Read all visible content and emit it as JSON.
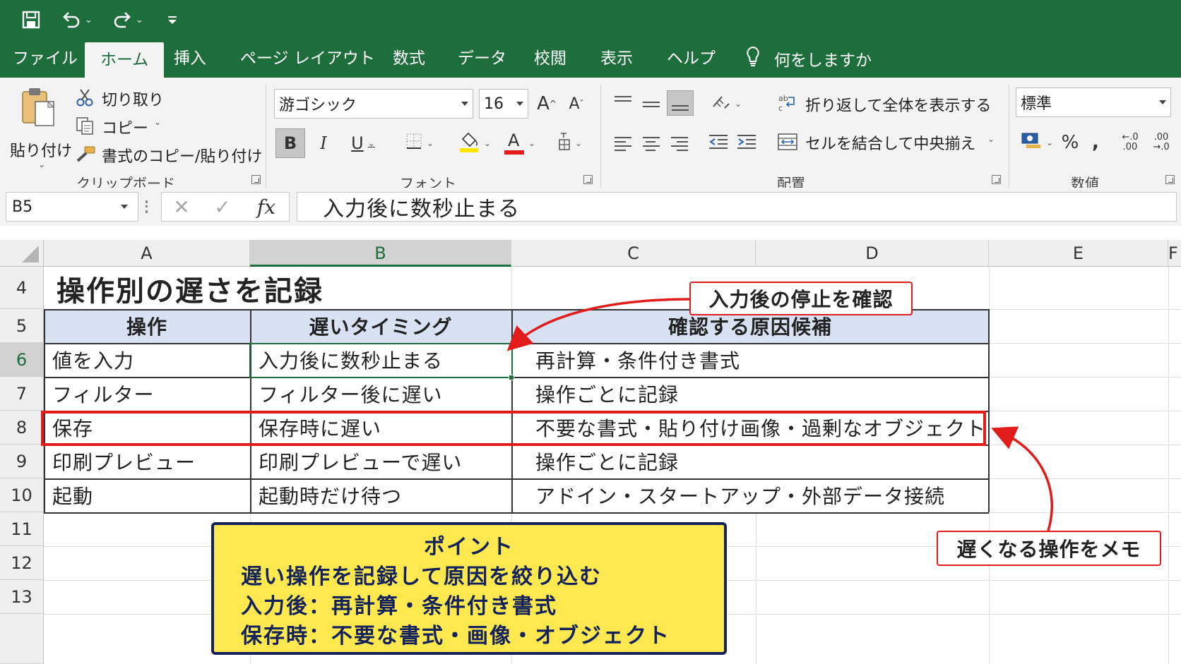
{
  "colors": {
    "excel_green": "#1e6e3c",
    "callout_red": "#e21b1b",
    "header_fill": "#d9e2f3",
    "point_fill": "#fde84f",
    "point_border": "#13225a"
  },
  "quick_access": {
    "icons": [
      "save-icon",
      "undo-icon",
      "redo-icon",
      "customize-icon"
    ]
  },
  "menu": {
    "tabs": [
      "ファイル",
      "ホーム",
      "挿入",
      "ページ レイアウト",
      "数式",
      "データ",
      "校閲",
      "表示",
      "ヘルプ"
    ],
    "active": "ホーム",
    "tell_me": "何をしますか"
  },
  "ribbon": {
    "clipboard": {
      "paste": "貼り付け",
      "cut": "切り取り",
      "copy": "コピー",
      "format_painter": "書式のコピー/貼り付け",
      "label": "クリップボード"
    },
    "font": {
      "font_name": "游ゴシック",
      "font_size": "16",
      "bold": "B",
      "italic": "I",
      "underline": "U",
      "font_color_glyph": "A",
      "grow_glyph": "A",
      "shrink_glyph": "A",
      "label": "フォント"
    },
    "alignment": {
      "wrap_text": "折り返して全体を表示する",
      "merge_center": "セルを結合して中央揃え",
      "label": "配置"
    },
    "number": {
      "format": "標準",
      "percent": "%",
      "comma": ",",
      "inc_decimal": "←.0 .00",
      "dec_decimal": ".00 →.0",
      "label": "数値"
    }
  },
  "formula_bar": {
    "name_box": "B5",
    "fx": "fx",
    "content": "入力後に数秒止まる"
  },
  "sheet": {
    "columns": [
      "A",
      "B",
      "C",
      "D",
      "E",
      "F"
    ],
    "rows": [
      "4",
      "5",
      "6",
      "7",
      "8",
      "9",
      "10",
      "11",
      "12",
      "13"
    ],
    "title": "操作別の遅さを記録",
    "headers": [
      "操作",
      "遅いタイミング",
      "確認する原因候補"
    ],
    "data_rows": [
      [
        "値を入力",
        "入力後に数秒止まる",
        "再計算・条件付き書式"
      ],
      [
        "フィルター",
        "フィルター後に遅い",
        "操作ごとに記録"
      ],
      [
        "保存",
        "保存時に遅い",
        "不要な書式・貼り付け画像・過剰なオブジェクト"
      ],
      [
        "印刷プレビュー",
        "印刷プレビューで遅い",
        "操作ごとに記録"
      ],
      [
        "起動",
        "起動時だけ待つ",
        "アドイン・スタートアップ・外部データ接続"
      ]
    ]
  },
  "callouts": {
    "top": "入力後の停止を確認",
    "right": "遅くなる操作をメモ"
  },
  "point_box": {
    "title": "ポイント",
    "lines": [
      "遅い操作を記録して原因を絞り込む",
      "入力後：再計算・条件付き書式",
      "保存時：不要な書式・画像・オブジェクト"
    ]
  }
}
